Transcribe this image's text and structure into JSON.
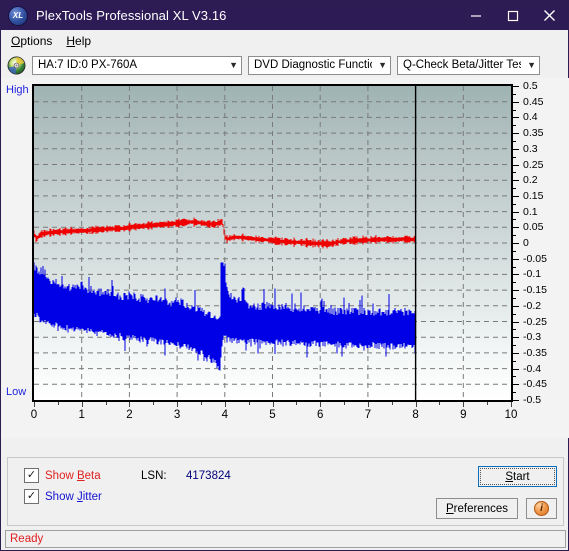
{
  "window": {
    "title": "PlexTools Professional XL V3.16",
    "icon": "xl-disc-icon",
    "icon_text": "XL",
    "minimize_label": "minimize-icon",
    "maximize_label": "maximize-icon",
    "close_label": "close-icon",
    "titlebar_color": "#2d1b56"
  },
  "menu": {
    "items": [
      {
        "label": "Options",
        "mnemonic": "O"
      },
      {
        "label": "Help",
        "mnemonic": "H"
      }
    ]
  },
  "toolbar": {
    "disc_icon": "cd-disc-icon",
    "drive_select": {
      "value": "HA:7 ID:0  PX-760A",
      "options": [
        "HA:7 ID:0  PX-760A"
      ]
    },
    "function_select": {
      "value": "DVD Diagnostic Functions",
      "options": [
        "DVD Diagnostic Functions"
      ]
    },
    "test_select": {
      "value": "Q-Check Beta/Jitter Test",
      "options": [
        "Q-Check Beta/Jitter Test"
      ]
    }
  },
  "chart_labels": {
    "high": "High",
    "low": "Low"
  },
  "controls": {
    "show_beta": {
      "label": "Show Beta",
      "mnemonic": "B",
      "checked": true,
      "color": "#e02020"
    },
    "show_jitter": {
      "label": "Show Jitter",
      "mnemonic": "J",
      "checked": true,
      "color": "#1414d2"
    },
    "lsn_label": "LSN:",
    "lsn_value": "4173824",
    "start_button": {
      "label": "Start",
      "mnemonic": "S"
    },
    "preferences_button": {
      "label": "Preferences",
      "mnemonic": "P"
    },
    "info_button": {
      "label": "i",
      "icon": "info-icon"
    }
  },
  "statusbar": {
    "text": "Ready"
  },
  "chart_data": {
    "type": "line",
    "title": "Q-Check Beta/Jitter Test",
    "xlabel": "",
    "ylabel": "",
    "xlim": [
      0,
      10
    ],
    "ylim": [
      -0.5,
      0.5
    ],
    "grid": true,
    "legend_position": "bottom-left",
    "xticks": [
      0,
      1,
      2,
      3,
      4,
      5,
      6,
      7,
      8,
      9,
      10
    ],
    "yticks": [
      0.5,
      0.45,
      0.4,
      0.35,
      0.3,
      0.25,
      0.2,
      0.15,
      0.1,
      0.05,
      0,
      -0.05,
      -0.1,
      -0.15,
      -0.2,
      -0.25,
      -0.3,
      -0.35,
      -0.4,
      -0.45,
      -0.5
    ],
    "data_end_x": 8.0,
    "marker_line_x": 8.0,
    "series": [
      {
        "name": "Show Beta",
        "color": "#ee0000",
        "x": [
          0.0,
          0.05,
          0.1,
          0.15,
          0.2,
          0.3,
          0.4,
          0.5,
          0.6,
          0.7,
          0.8,
          0.9,
          1.0,
          1.1,
          1.2,
          1.3,
          1.4,
          1.5,
          1.6,
          1.7,
          1.8,
          1.9,
          2.0,
          2.1,
          2.2,
          2.3,
          2.4,
          2.5,
          2.6,
          2.7,
          2.8,
          2.9,
          3.0,
          3.1,
          3.2,
          3.3,
          3.4,
          3.5,
          3.6,
          3.7,
          3.8,
          3.85,
          3.9,
          3.95,
          4.0,
          4.05,
          4.1,
          4.2,
          4.3,
          4.4,
          4.5,
          4.6,
          4.7,
          4.8,
          4.9,
          5.0,
          5.1,
          5.2,
          5.3,
          5.4,
          5.5,
          5.6,
          5.7,
          5.8,
          5.9,
          6.0,
          6.1,
          6.2,
          6.3,
          6.4,
          6.5,
          6.6,
          6.7,
          6.8,
          6.9,
          7.0,
          7.1,
          7.2,
          7.3,
          7.4,
          7.5,
          7.6,
          7.7,
          7.8,
          7.9,
          8.0
        ],
        "y": [
          0.03,
          0.012,
          0.022,
          0.028,
          0.03,
          0.032,
          0.034,
          0.035,
          0.036,
          0.037,
          0.038,
          0.038,
          0.04,
          0.038,
          0.041,
          0.042,
          0.043,
          0.044,
          0.045,
          0.046,
          0.046,
          0.047,
          0.05,
          0.052,
          0.053,
          0.054,
          0.056,
          0.057,
          0.058,
          0.059,
          0.06,
          0.061,
          0.063,
          0.065,
          0.066,
          0.067,
          0.066,
          0.064,
          0.062,
          0.06,
          0.06,
          0.062,
          0.065,
          0.068,
          0.02,
          0.012,
          0.016,
          0.018,
          0.018,
          0.017,
          0.015,
          0.014,
          0.012,
          0.011,
          0.01,
          0.008,
          0.006,
          0.005,
          0.004,
          0.003,
          0.002,
          0.002,
          0.001,
          0.0,
          -0.001,
          -0.002,
          -0.002,
          -0.003,
          0.0,
          0.004,
          0.006,
          0.007,
          0.008,
          0.008,
          0.009,
          0.01,
          0.01,
          0.011,
          0.011,
          0.012,
          0.01,
          0.011,
          0.012,
          0.012,
          0.011,
          0.012
        ]
      },
      {
        "name": "Show Jitter",
        "color": "#0000e6",
        "band": true,
        "x": [
          0.0,
          0.1,
          0.2,
          0.3,
          0.4,
          0.5,
          0.6,
          0.7,
          0.8,
          0.9,
          1.0,
          1.1,
          1.2,
          1.3,
          1.4,
          1.5,
          1.6,
          1.7,
          1.8,
          1.9,
          2.0,
          2.1,
          2.2,
          2.3,
          2.4,
          2.5,
          2.6,
          2.7,
          2.8,
          2.9,
          3.0,
          3.1,
          3.2,
          3.3,
          3.4,
          3.5,
          3.6,
          3.7,
          3.8,
          3.9,
          3.95,
          4.0,
          4.05,
          4.1,
          4.2,
          4.3,
          4.4,
          4.5,
          4.6,
          4.7,
          4.8,
          4.9,
          5.0,
          5.1,
          5.2,
          5.3,
          5.4,
          5.5,
          5.6,
          5.7,
          5.8,
          5.9,
          6.0,
          6.1,
          6.2,
          6.3,
          6.4,
          6.5,
          6.6,
          6.7,
          6.8,
          6.9,
          7.0,
          7.1,
          7.2,
          7.3,
          7.4,
          7.5,
          7.6,
          7.7,
          7.8,
          7.9,
          8.0
        ],
        "y_upper": [
          -0.09,
          -0.11,
          -0.1,
          -0.13,
          -0.14,
          -0.145,
          -0.15,
          -0.155,
          -0.16,
          -0.16,
          -0.15,
          -0.16,
          -0.165,
          -0.17,
          -0.17,
          -0.175,
          -0.175,
          -0.18,
          -0.185,
          -0.185,
          -0.18,
          -0.185,
          -0.19,
          -0.19,
          -0.195,
          -0.19,
          -0.195,
          -0.2,
          -0.2,
          -0.205,
          -0.2,
          -0.205,
          -0.21,
          -0.215,
          -0.22,
          -0.225,
          -0.235,
          -0.245,
          -0.255,
          -0.265,
          -0.13,
          -0.15,
          -0.17,
          -0.185,
          -0.19,
          -0.2,
          -0.205,
          -0.21,
          -0.215,
          -0.215,
          -0.215,
          -0.21,
          -0.21,
          -0.215,
          -0.215,
          -0.22,
          -0.22,
          -0.22,
          -0.225,
          -0.225,
          -0.225,
          -0.225,
          -0.225,
          -0.225,
          -0.225,
          -0.23,
          -0.23,
          -0.23,
          -0.23,
          -0.23,
          -0.23,
          -0.23,
          -0.23,
          -0.235,
          -0.235,
          -0.235,
          -0.235,
          -0.235,
          -0.235,
          -0.235,
          -0.235,
          -0.235,
          -0.235
        ],
        "y_lower": [
          -0.21,
          -0.23,
          -0.235,
          -0.245,
          -0.25,
          -0.255,
          -0.255,
          -0.26,
          -0.265,
          -0.265,
          -0.265,
          -0.27,
          -0.27,
          -0.275,
          -0.275,
          -0.28,
          -0.28,
          -0.285,
          -0.285,
          -0.29,
          -0.29,
          -0.29,
          -0.295,
          -0.295,
          -0.3,
          -0.3,
          -0.305,
          -0.305,
          -0.31,
          -0.31,
          -0.312,
          -0.315,
          -0.318,
          -0.322,
          -0.33,
          -0.338,
          -0.348,
          -0.36,
          -0.372,
          -0.385,
          -0.3,
          -0.29,
          -0.295,
          -0.3,
          -0.3,
          -0.3,
          -0.302,
          -0.302,
          -0.304,
          -0.304,
          -0.305,
          -0.305,
          -0.305,
          -0.306,
          -0.306,
          -0.308,
          -0.308,
          -0.308,
          -0.31,
          -0.31,
          -0.31,
          -0.31,
          -0.31,
          -0.312,
          -0.312,
          -0.312,
          -0.312,
          -0.314,
          -0.314,
          -0.314,
          -0.314,
          -0.315,
          -0.315,
          -0.316,
          -0.316,
          -0.316,
          -0.317,
          -0.317,
          -0.318,
          -0.318,
          -0.318,
          -0.318,
          -0.318
        ],
        "spike_x": 3.97,
        "spike_top": -0.075
      }
    ]
  }
}
